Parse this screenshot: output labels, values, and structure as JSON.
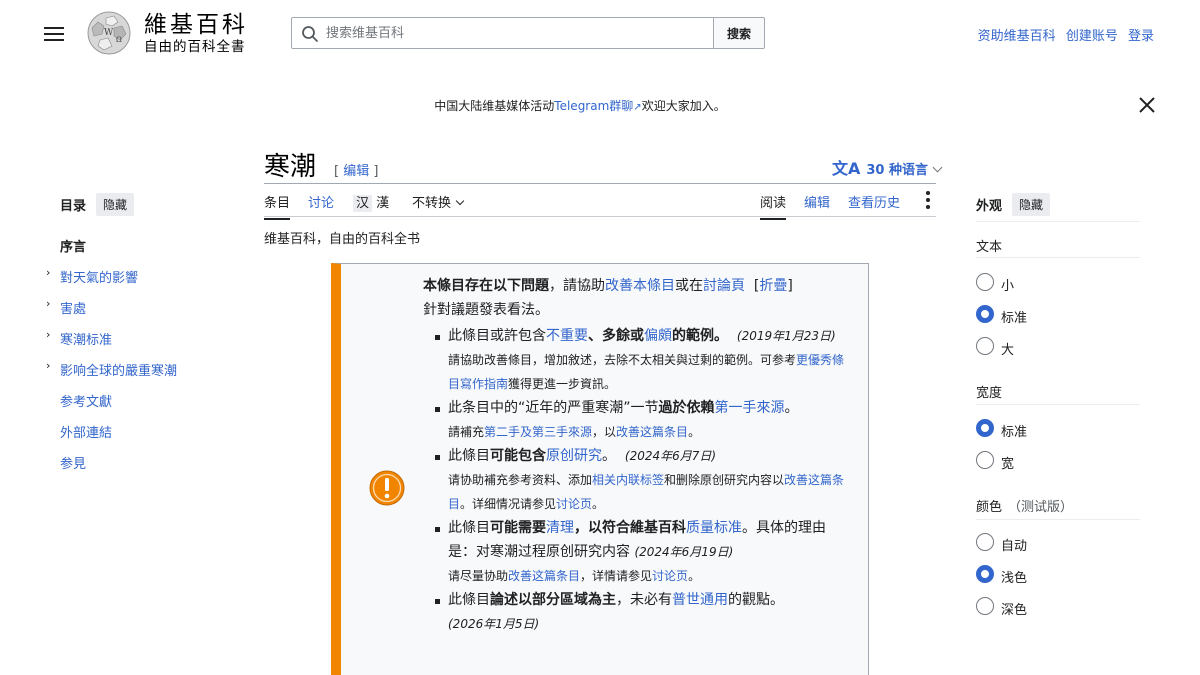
{
  "header": {
    "wordmark_title": "維基百科",
    "wordmark_tagline": "自由的百科全書",
    "search_placeholder": "搜索维基百科",
    "search_button": "搜索",
    "user_links": [
      "资助维基百科",
      "创建账号",
      "登录"
    ]
  },
  "banner": {
    "prefix": "中国大陆维基媒体活动",
    "link": "Telegram群聊",
    "suffix": "欢迎大家加入。"
  },
  "article": {
    "title": "寒潮",
    "edit_link": "编辑",
    "languages": "30 种语言",
    "tabs_left": [
      "条目",
      "讨论"
    ],
    "variant_a": "汉",
    "variant_b": "漢",
    "variant_dropdown": "不转换",
    "tabs_right": [
      "阅读",
      "编辑",
      "查看历史"
    ],
    "tagline": "维基百科，自由的百科全书"
  },
  "toc": {
    "title": "目录",
    "hide": "隐藏",
    "items": [
      "序言",
      "對天氣的影響",
      "害處",
      "寒潮标准",
      "影响全球的嚴重寒潮",
      "参考文獻",
      "外部連結",
      "参見"
    ]
  },
  "appearance": {
    "title": "外观",
    "hide": "隐藏",
    "text_label": "文本",
    "text_options": [
      "小",
      "标准",
      "大"
    ],
    "width_label": "宽度",
    "width_options": [
      "标准",
      "宽"
    ],
    "color_label": "颜色",
    "color_note": "（测试版）",
    "color_options": [
      "自动",
      "浅色",
      "深色"
    ],
    "selected_text": "标准",
    "selected_width": "标准",
    "selected_color": "浅色"
  },
  "ambox": {
    "main_bold": "本條目存在以下問題",
    "main_mid": "，請協助",
    "main_link1": "改善本條目",
    "main_or": "或在",
    "main_link2": "討論頁",
    "main_collapse": "折疊",
    "main_tail": "針對議題發表看法。",
    "item1": {
      "a": "此條目或許包含",
      "link1": "不重要",
      "b": "、",
      "c": "多餘",
      "d": "或",
      "link2": "偏頗",
      "e": "的範例。",
      "date": "(2019年1月23日)",
      "sub_a": "請協助改善條目，增加敘述，去除不太相关與过剩的範例。可参考",
      "sub_link": "更優秀條目寫作指南",
      "sub_b": "獲得更進一步資訊。"
    },
    "item2": {
      "a": "此条目中的“近年的严重寒潮”一节",
      "b": "過於依賴",
      "link1": "第一手來源",
      "c": "。",
      "sub_a": "請補充",
      "sub_link1": "第二手及第三手來源",
      "sub_b": "，以",
      "sub_link2": "改善这篇条目",
      "sub_c": "。"
    },
    "item3": {
      "a": "此條目",
      "b": "可能包含",
      "link1": "原创研究",
      "c": "。",
      "date": "(2024年6月7日)",
      "sub_a": "请协助補充参考资料、添加",
      "sub_link1": "相关内联标签",
      "sub_b": "和删除原创研究内容以",
      "sub_link2": "改善这篇条目",
      "sub_c": "。详细情况请参见",
      "sub_link3": "讨论页",
      "sub_d": "。"
    },
    "item4": {
      "a": "此條目",
      "b": "可能需要",
      "link1": "清理",
      "c": "，以符合",
      "d": "維基百科",
      "link2": "质量标准",
      "e": "。具体的理由是：对寒潮过程原创研究内容",
      "date": "(2024年6月19日)",
      "sub_a": "请尽量协助",
      "sub_link1": "改善这篇条目",
      "sub_b": "，详情请参见",
      "sub_link2": "讨论页",
      "sub_c": "。"
    },
    "item5": {
      "a": "此條目",
      "b": "論述以部分區域為主",
      "c": "，未必有",
      "link1": "普世通用",
      "d": "的觀點。",
      "date": "(2026年1月5日)"
    }
  },
  "colors": {
    "link": "#3366cc",
    "ambox_accent": "#f28500",
    "text": "#202122"
  }
}
